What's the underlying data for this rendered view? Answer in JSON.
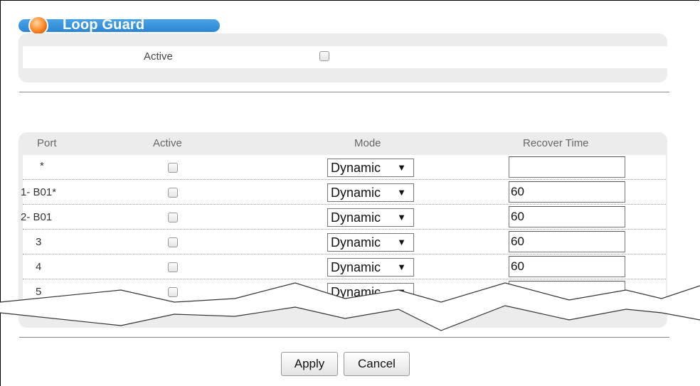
{
  "title": "Loop Guard",
  "global": {
    "active_label": "Active",
    "active_checked": false
  },
  "table": {
    "headers": {
      "port": "Port",
      "active": "Active",
      "mode": "Mode",
      "recover": "Recover Time"
    },
    "rows": [
      {
        "port": "*",
        "active": false,
        "mode": "Dynamic",
        "recover": ""
      },
      {
        "port": "1- B01*",
        "active": false,
        "mode": "Dynamic",
        "recover": "60"
      },
      {
        "port": "2- B01",
        "active": false,
        "mode": "Dynamic",
        "recover": "60"
      },
      {
        "port": "3",
        "active": false,
        "mode": "Dynamic",
        "recover": "60"
      },
      {
        "port": "4",
        "active": false,
        "mode": "Dynamic",
        "recover": "60"
      },
      {
        "port": "5",
        "active": false,
        "mode": "Dynamic",
        "recover": ""
      }
    ],
    "dropdown_arrow": "▼"
  },
  "buttons": {
    "apply": "Apply",
    "cancel": "Cancel"
  },
  "colors": {
    "title_bar": "#2b86d3",
    "panel": "#ececec"
  }
}
